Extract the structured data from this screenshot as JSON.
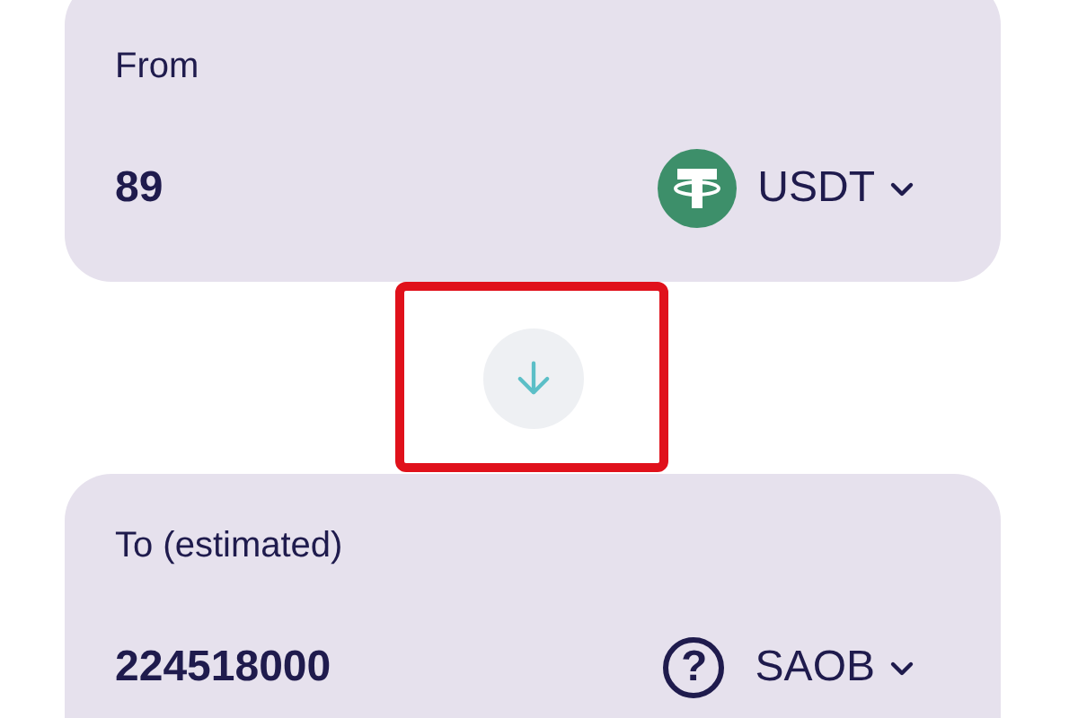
{
  "from": {
    "label": "From",
    "amount": "89",
    "token": {
      "kind": "tether",
      "symbol": "USDT"
    }
  },
  "swap": {
    "highlighted": true
  },
  "to": {
    "label": "To (estimated)",
    "amount": "224518000",
    "token": {
      "kind": "unknown",
      "symbol": "SAOB",
      "glyph": "?"
    }
  }
}
